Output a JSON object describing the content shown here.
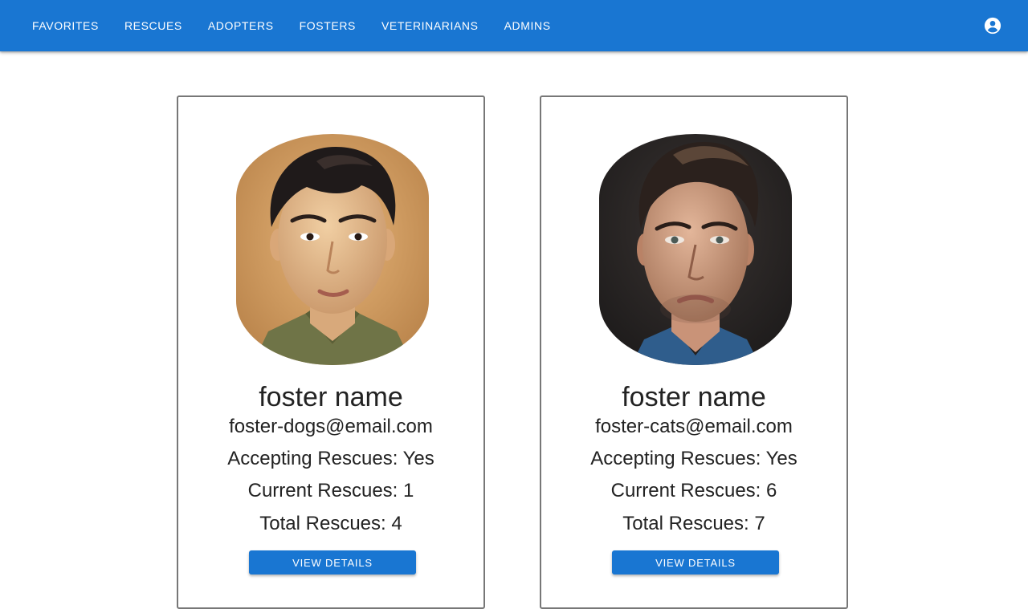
{
  "header": {
    "nav_items": [
      {
        "label": "FAVORITES"
      },
      {
        "label": "RESCUES"
      },
      {
        "label": "ADOPTERS"
      },
      {
        "label": "FOSTERS"
      },
      {
        "label": "VETERINARIANS"
      },
      {
        "label": "ADMINS"
      }
    ],
    "account_icon": "account-circle-icon",
    "background_color": "#1976d2"
  },
  "fosters": [
    {
      "name": "foster name",
      "email": "foster-dogs@email.com",
      "accepting": "Accepting Rescues: Yes",
      "current": "Current Rescues: 1",
      "total": "Total Rescues: 4",
      "button_label": "VIEW DETAILS"
    },
    {
      "name": "foster name",
      "email": "foster-cats@email.com",
      "accepting": "Accepting Rescues: Yes",
      "current": "Current Rescues: 6",
      "total": "Total Rescues: 7",
      "button_label": "VIEW DETAILS"
    }
  ],
  "button_color": "#1976d2"
}
